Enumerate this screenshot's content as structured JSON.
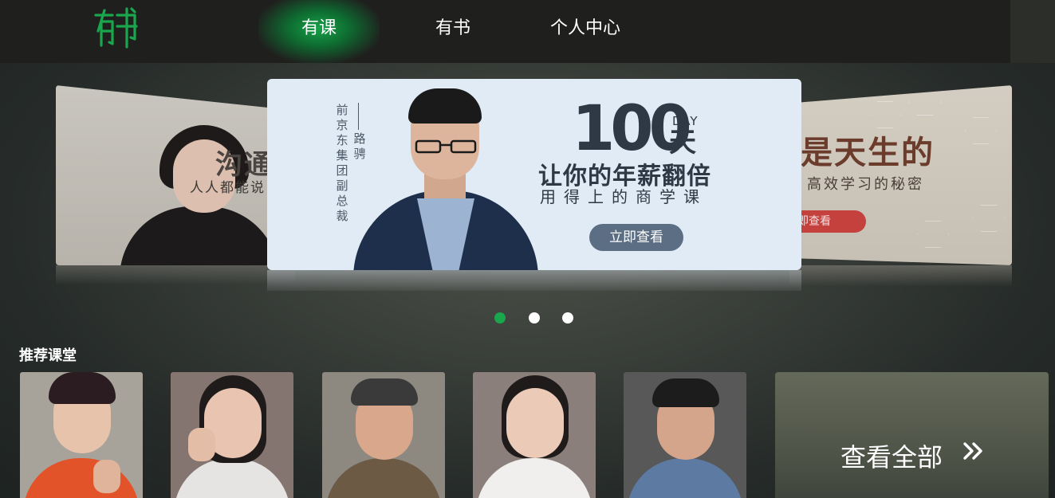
{
  "header": {
    "logo_text": "有书",
    "nav": [
      {
        "label": "有课",
        "active": true
      },
      {
        "label": "有书",
        "active": false
      },
      {
        "label": "个人中心",
        "active": false
      }
    ],
    "accent_color": "#1aa64c"
  },
  "carousel": {
    "left_slide": {
      "title": "沟通",
      "subtitle": "人人都能说"
    },
    "main_slide": {
      "speaker_title": "前京东集团副总裁",
      "speaker_name": "路骋",
      "number": "100",
      "day_en": "DAY",
      "day_cn": "天",
      "headline": "让你的年薪翻倍",
      "subline": "用得上的商学课",
      "button": "立即查看"
    },
    "right_slide": {
      "title": "是天生的",
      "subtitle": "高效学习的秘密",
      "button": "即查看"
    },
    "dots": [
      {
        "active": true
      },
      {
        "active": false
      },
      {
        "active": false
      }
    ]
  },
  "recommended": {
    "title": "推荐课堂",
    "view_all": "查看全部"
  }
}
